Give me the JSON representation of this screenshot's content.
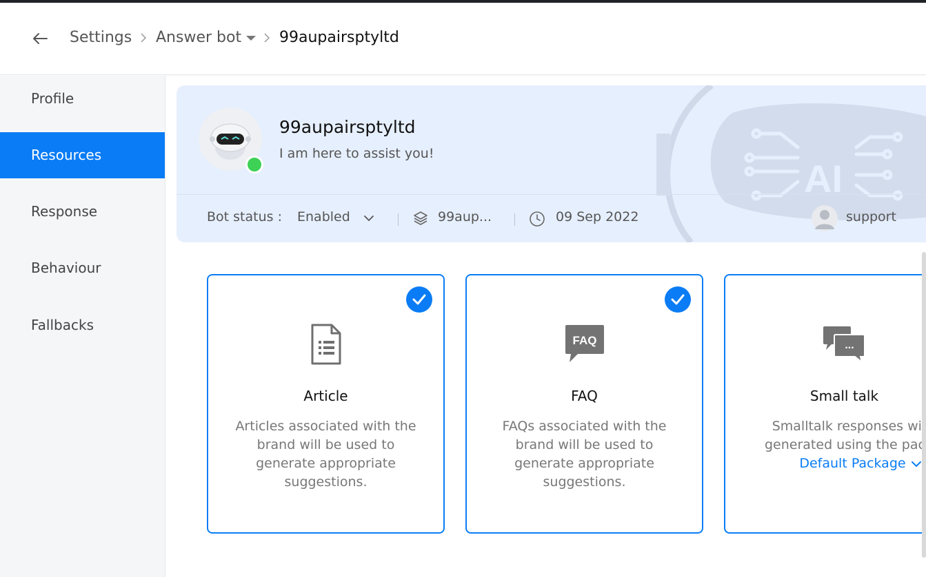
{
  "header": {
    "breadcrumb": [
      "Settings",
      "Answer bot",
      "99aupairsptyltd"
    ]
  },
  "sidebar": {
    "items": [
      {
        "label": "Profile"
      },
      {
        "label": "Resources"
      },
      {
        "label": "Response"
      },
      {
        "label": "Behaviour"
      },
      {
        "label": "Fallbacks"
      }
    ],
    "active": "Resources"
  },
  "bot": {
    "name": "99aupairsptyltd",
    "tagline": "I am here to assist you!",
    "status_label": "Bot status :",
    "status_value": "Enabled",
    "brand": "99aup...",
    "date": "09 Sep 2022",
    "owner": "support",
    "online_color": "#3dd155"
  },
  "resources": [
    {
      "title": "Article",
      "description": "Articles associated with the brand will be used to generate appropriate suggestions.",
      "selected": true,
      "icon": "article-icon"
    },
    {
      "title": "FAQ",
      "description": "FAQs associated with the brand will be used to generate appropriate suggestions.",
      "selected": true,
      "icon": "faq-icon",
      "icon_text": "FAQ"
    },
    {
      "title": "Small talk",
      "description": "Smalltalk responses will be generated using the package",
      "package": "Default Package",
      "selected": false,
      "icon": "chat-bubbles-icon",
      "icon_text": "..."
    }
  ],
  "colors": {
    "accent": "#0a7cf5",
    "card_bg": "#e6effd",
    "sidebar_bg": "#f5f6f8"
  }
}
